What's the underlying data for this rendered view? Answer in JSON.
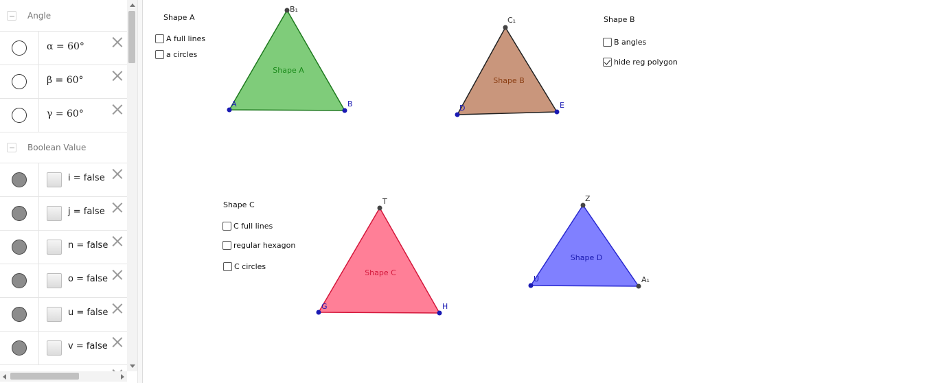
{
  "algebra": {
    "groups": [
      {
        "label": "Angle",
        "rows": [
          {
            "text": "α = 60°"
          },
          {
            "text": "β = 60°"
          },
          {
            "text": "γ = 60°"
          }
        ]
      },
      {
        "label": "Boolean Value",
        "rows": [
          {
            "text": "i = false"
          },
          {
            "text": "j = false"
          },
          {
            "text": "n = false"
          },
          {
            "text": "o = false"
          },
          {
            "text": "u = false"
          },
          {
            "text": "v = false"
          }
        ]
      }
    ]
  },
  "graphics": {
    "shapeA": {
      "title": "Shape A",
      "checkboxes": [
        {
          "label": "A full lines",
          "checked": false
        },
        {
          "label": "a circles",
          "checked": false
        }
      ],
      "polygon_label": "Shape A",
      "fill": "#7fcc7a",
      "stroke": "#1f7a1f",
      "label_color": "#1a8a1a",
      "vertices": {
        "v1": "A",
        "v2": "B",
        "v3": "B₁"
      }
    },
    "shapeB": {
      "title": "Shape B",
      "checkboxes": [
        {
          "label": "B angles",
          "checked": false
        },
        {
          "label": "hide reg polygon",
          "checked": true
        }
      ],
      "polygon_label": "Shape B",
      "fill": "#c9967c",
      "stroke": "#222222",
      "label_color": "#8b3f14",
      "vertices": {
        "v1": "D",
        "v2": "E",
        "v3": "C₁"
      }
    },
    "shapeC": {
      "title": "Shape C",
      "checkboxes": [
        {
          "label": "C full lines",
          "checked": false
        },
        {
          "label": "regular hexagon",
          "checked": false
        },
        {
          "label": "C circles",
          "checked": false
        }
      ],
      "polygon_label": "Shape C",
      "fill": "#ff7f97",
      "stroke": "#d4183c",
      "label_color": "#d4183c",
      "vertices": {
        "v1": "G",
        "v2": "H",
        "v3": "T"
      }
    },
    "shapeD": {
      "polygon_label": "Shape D",
      "fill": "#8080ff",
      "stroke": "#2a2ad0",
      "label_color": "#1a1ab0",
      "vertices": {
        "v1": "U",
        "v2": "A₁",
        "v3": "Z"
      }
    },
    "point_color": "#1a1ab3",
    "dark_point_color": "#444444"
  }
}
